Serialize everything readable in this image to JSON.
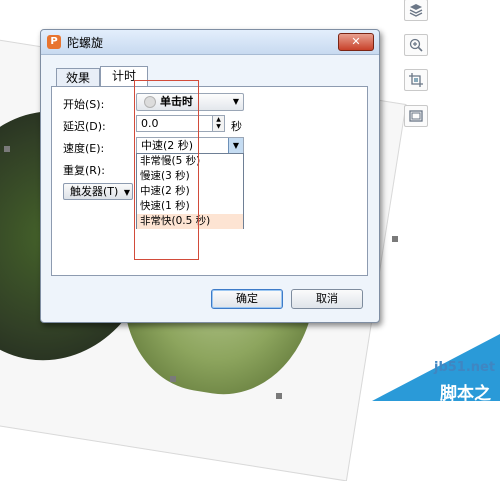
{
  "dialog": {
    "title": "陀螺旋",
    "close_symbol": "✕",
    "icon_letter": "P",
    "accent_color": "#e8742f"
  },
  "tabs": [
    {
      "label": "效果",
      "active": false
    },
    {
      "label": "计时",
      "active": true
    }
  ],
  "fields": {
    "start_label": "开始(S):",
    "start_value": "单击时",
    "delay_label": "延迟(D):",
    "delay_value": "0.0",
    "delay_unit": "秒",
    "speed_label": "速度(E):",
    "speed_value": "中速(2 秒)",
    "repeat_label": "重复(R):"
  },
  "speed_options": [
    {
      "label": "非常慢(5 秒)",
      "selected": false
    },
    {
      "label": "慢速(3 秒)",
      "selected": false
    },
    {
      "label": "中速(2 秒)",
      "selected": false
    },
    {
      "label": "快速(1 秒)",
      "selected": false
    },
    {
      "label": "非常快(0.5 秒)",
      "selected": true
    }
  ],
  "buttons": {
    "trigger_label": "触发器(T)",
    "ok_label": "确定",
    "cancel_label": "取消"
  },
  "toolbar_icons": [
    "layers-icon",
    "zoom-in-icon",
    "crop-image-icon",
    "slide-frame-icon"
  ],
  "watermark": {
    "site": "jb51.net",
    "name": "脚本之家",
    "color": "#2a9ad8"
  }
}
